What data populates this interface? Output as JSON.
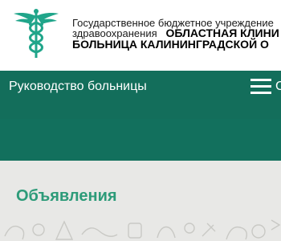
{
  "header": {
    "logo_icon": "caduceus-icon",
    "org_line1": "Государственное бюджетное учреждение",
    "org_line2_prefix": "здравоохранения",
    "org_line2_bold": "ОБЛАСТНАЯ КЛИНИ",
    "org_line3": "БОЛЬНИЦА КАЛИНИНГРАДСКОЙ О"
  },
  "nav": {
    "title": "Руководство больницы",
    "menu_icon": "hamburger-menu-icon",
    "menu_letter": "С"
  },
  "main": {
    "section_title": "Объявления"
  },
  "colors": {
    "brand_green": "#136e5b",
    "title_green": "#2d9b79",
    "content_bg": "#e8e8e6"
  }
}
